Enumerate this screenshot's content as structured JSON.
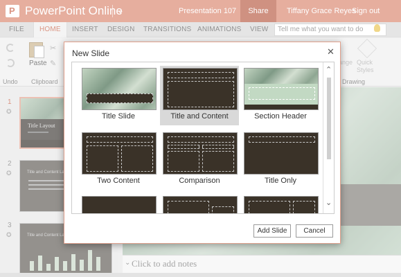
{
  "titlebar": {
    "app_name": "PowerPoint Online",
    "document_name": "Presentation 107",
    "share_label": "Share",
    "user_name": "Tiffany Grace Reyes",
    "sign_out_label": "Sign out"
  },
  "ribbon_tabs": [
    {
      "label": "FILE"
    },
    {
      "label": "HOME",
      "active": true
    },
    {
      "label": "INSERT"
    },
    {
      "label": "DESIGN"
    },
    {
      "label": "TRANSITIONS"
    },
    {
      "label": "ANIMATIONS"
    },
    {
      "label": "VIEW"
    }
  ],
  "tell_me_placeholder": "Tell me what you want to do",
  "ribbon": {
    "undo_group_label": "Undo",
    "clipboard_group_label": "Clipboard",
    "paste_label": "Paste",
    "drawing_group_label": "Drawing",
    "arrange_label": "ange",
    "quick_styles_label": "Quick Styles"
  },
  "slides": [
    {
      "number": "1",
      "title": "Title Layout",
      "selected": true
    },
    {
      "number": "2",
      "title": "Title and Content Layout"
    },
    {
      "number": "3",
      "title": "Title and Content Layout"
    }
  ],
  "notes_placeholder": "Click to add notes",
  "dialog": {
    "title": "New Slide",
    "layouts": [
      {
        "label": "Title Slide"
      },
      {
        "label": "Title and Content",
        "selected": true
      },
      {
        "label": "Section Header"
      },
      {
        "label": "Two Content"
      },
      {
        "label": "Comparison"
      },
      {
        "label": "Title Only"
      }
    ],
    "add_button": "Add Slide",
    "cancel_button": "Cancel"
  },
  "colors": {
    "accent": "#d9836b",
    "accent_dark": "#b5573e",
    "slide_dark": "#3a3228",
    "slide_green": "#c2d9c3"
  }
}
